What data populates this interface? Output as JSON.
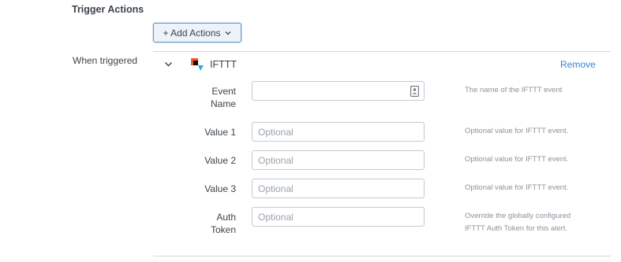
{
  "section": {
    "title": "Trigger Actions"
  },
  "add_button": {
    "label": "+ Add Actions"
  },
  "trigger": {
    "label": "When triggered",
    "action_name": "IFTTT",
    "remove_label": "Remove"
  },
  "fields": [
    {
      "label_line1": "Event",
      "label_line2": "Name",
      "value": "",
      "placeholder": "",
      "help_line1": "The name of the IFTTT event",
      "help_line2": ""
    },
    {
      "label_line1": "Value 1",
      "label_line2": "",
      "value": "",
      "placeholder": "Optional",
      "help_line1": "Optional value for IFTTT event.",
      "help_line2": ""
    },
    {
      "label_line1": "Value 2",
      "label_line2": "",
      "value": "",
      "placeholder": "Optional",
      "help_line1": "Optional value for IFTTT event.",
      "help_line2": ""
    },
    {
      "label_line1": "Value 3",
      "label_line2": "",
      "value": "",
      "placeholder": "Optional",
      "help_line1": "Optional value for IFTTT event.",
      "help_line2": ""
    },
    {
      "label_line1": "Auth",
      "label_line2": "Token",
      "value": "",
      "placeholder": "Optional",
      "help_line1": "Override the globally configured",
      "help_line2": "IFTTT Auth Token for this alert."
    }
  ],
  "icons": {
    "add_chevron": "chevron-down-icon",
    "collapse": "chevron-down-icon",
    "logo": "ifttt-logo-icon",
    "contact_card": "contact-card-icon"
  },
  "colors": {
    "link": "#3c82c8",
    "button_border": "#6c96c9",
    "logo_orange": "#f05a24",
    "logo_blue": "#33a9e0"
  }
}
